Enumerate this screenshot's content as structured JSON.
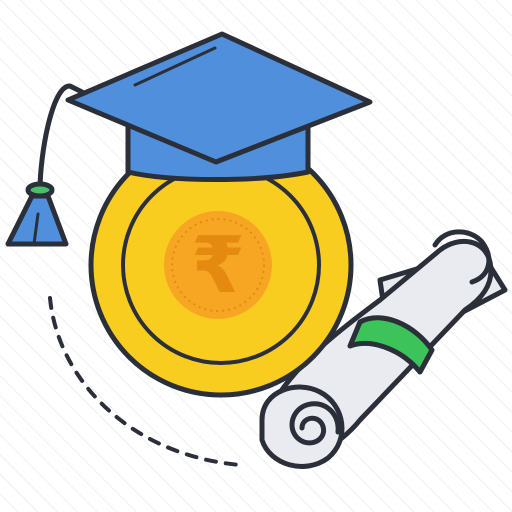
{
  "icon": {
    "name": "education-loan-rupee-icon",
    "parts": [
      "graduation-cap-icon",
      "rupee-coin-icon",
      "diploma-scroll-icon",
      "dashed-arc-path"
    ],
    "currency_symbol": "₹"
  },
  "colors": {
    "outline": "#2b2f3a",
    "cap_blue": "#4f8fdc",
    "coin_yellow": "#f9cd1f",
    "coin_inner_orange": "#f6a623",
    "rupee_orange": "#e58a10",
    "tassel_cord_green": "#49c16a",
    "scroll_gray": "#e9ebf0",
    "scroll_band_green": "#3cc45a",
    "background_stripes": "#eef0f4"
  }
}
